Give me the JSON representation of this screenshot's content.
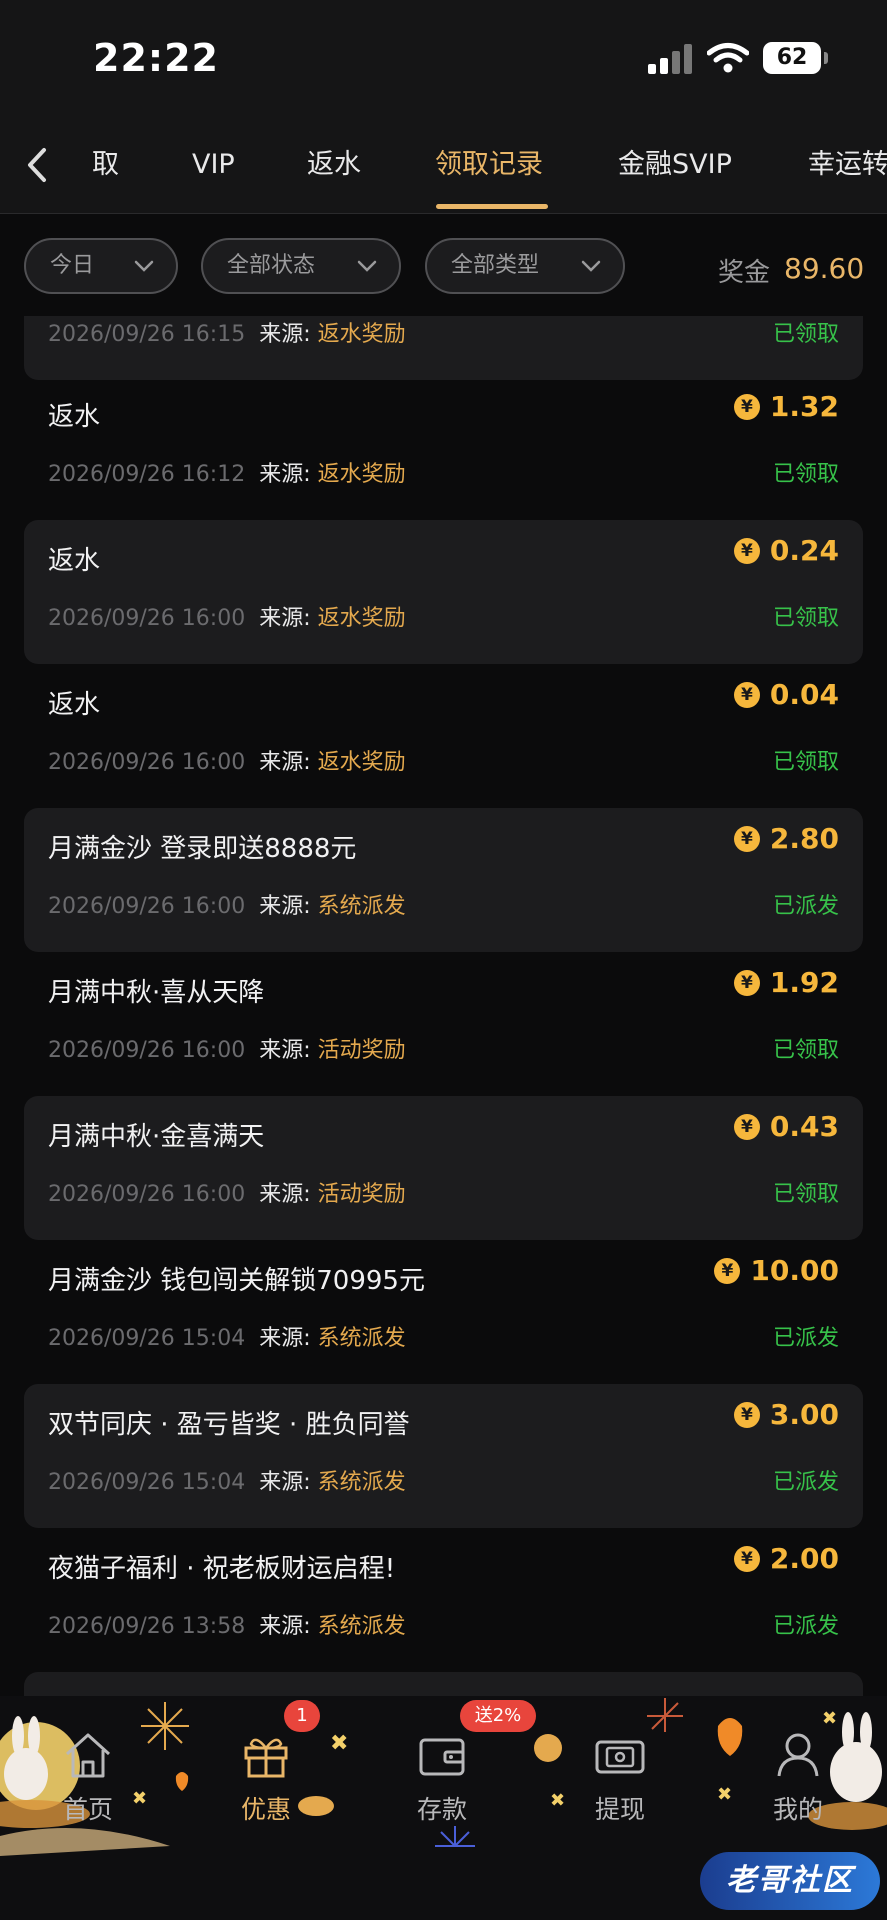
{
  "status_bar": {
    "time": "22:22",
    "battery": "62"
  },
  "tabs": [
    "取",
    "VIP",
    "返水",
    "领取记录",
    "金融SVIP",
    "幸运转"
  ],
  "active_tab": "领取记录",
  "filters": {
    "date": "今日",
    "status": "全部状态",
    "type": "全部类型"
  },
  "bonus": {
    "label": "奖金",
    "value": "89.60"
  },
  "source_label": "来源:",
  "coin_symbol": "¥",
  "records": [
    {
      "title": "",
      "date": "2026/09/26 16:15",
      "source": "返水奖励",
      "amount": "",
      "status": "已领取"
    },
    {
      "title": "返水",
      "date": "2026/09/26 16:12",
      "source": "返水奖励",
      "amount": "1.32",
      "status": "已领取"
    },
    {
      "title": "返水",
      "date": "2026/09/26 16:00",
      "source": "返水奖励",
      "amount": "0.24",
      "status": "已领取"
    },
    {
      "title": "返水",
      "date": "2026/09/26 16:00",
      "source": "返水奖励",
      "amount": "0.04",
      "status": "已领取"
    },
    {
      "title": "月满金沙 登录即送8888元",
      "date": "2026/09/26 16:00",
      "source": "系统派发",
      "amount": "2.80",
      "status": "已派发"
    },
    {
      "title": "月满中秋·喜从天降",
      "date": "2026/09/26 16:00",
      "source": "活动奖励",
      "amount": "1.92",
      "status": "已领取"
    },
    {
      "title": "月满中秋·金喜满天",
      "date": "2026/09/26 16:00",
      "source": "活动奖励",
      "amount": "0.43",
      "status": "已领取"
    },
    {
      "title": "月满金沙 钱包闯关解锁70995元",
      "date": "2026/09/26 15:04",
      "source": "系统派发",
      "amount": "10.00",
      "status": "已派发"
    },
    {
      "title": "双节同庆 · 盈亏皆奖 · 胜负同誉",
      "date": "2026/09/26 15:04",
      "source": "系统派发",
      "amount": "3.00",
      "status": "已派发"
    },
    {
      "title": "夜猫子福利 · 祝老板财运启程!",
      "date": "2026/09/26 13:58",
      "source": "系统派发",
      "amount": "2.00",
      "status": "已派发"
    }
  ],
  "bottom_nav": [
    {
      "label": "首页",
      "icon": "home-icon"
    },
    {
      "label": "优惠",
      "icon": "gift-icon",
      "badge": "1"
    },
    {
      "label": "存款",
      "icon": "wallet-icon",
      "badge": "送2%"
    },
    {
      "label": "提现",
      "icon": "withdraw-icon"
    },
    {
      "label": "我的",
      "icon": "user-icon"
    }
  ],
  "watermark": "老哥社区",
  "colors": {
    "accent": "#e9b668",
    "coin": "#f6b73c",
    "status_green": "#37c24a",
    "badge_red": "#e8453c"
  }
}
